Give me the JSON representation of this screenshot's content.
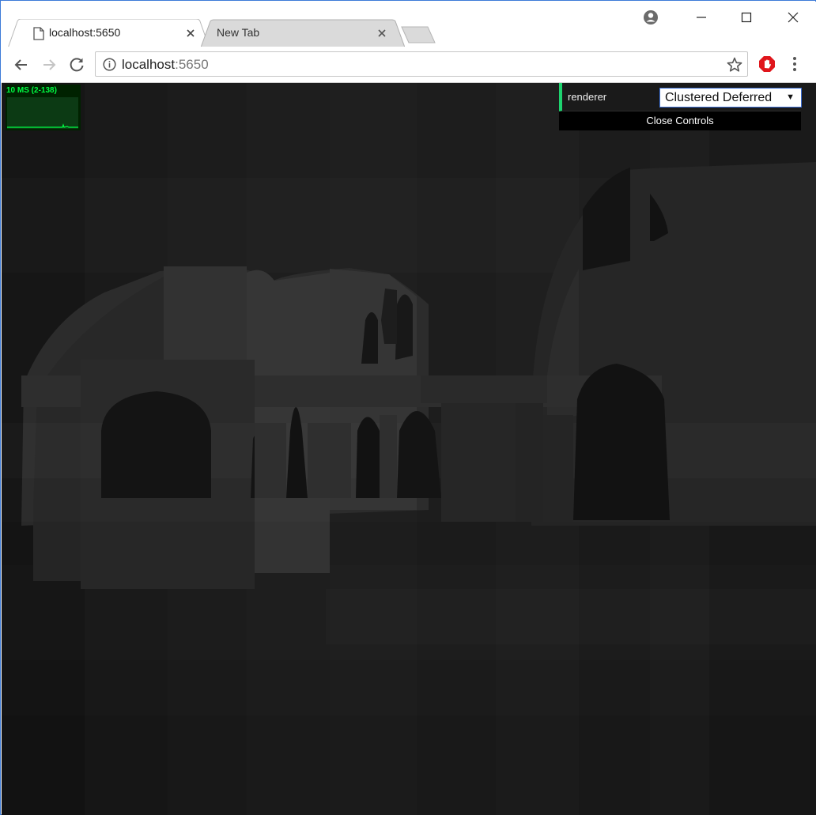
{
  "tabs": [
    {
      "title": "localhost:5650",
      "active": true
    },
    {
      "title": "New Tab",
      "active": false
    }
  ],
  "address_bar": {
    "host": "localhost",
    "port": ":5650"
  },
  "stats": {
    "label": "10 MS (2-138)",
    "color": "#00ff44"
  },
  "gui": {
    "controls": [
      {
        "label": "renderer",
        "value": "Clustered Deferred",
        "arrow": "▼"
      }
    ],
    "close_label": "Close Controls",
    "accent": "#1ed36f"
  },
  "icons": {
    "tab_page": "page-icon",
    "tab_close": "close-icon",
    "window_minimize": "minimize-icon",
    "window_maximize": "maximize-icon",
    "window_close": "close-icon",
    "profile": "profile-icon",
    "back": "back-arrow-icon",
    "forward": "forward-arrow-icon",
    "reload": "reload-icon",
    "site_info": "info-icon",
    "bookmark": "star-icon",
    "extension": "adblock-icon",
    "menu": "kebab-menu-icon"
  }
}
